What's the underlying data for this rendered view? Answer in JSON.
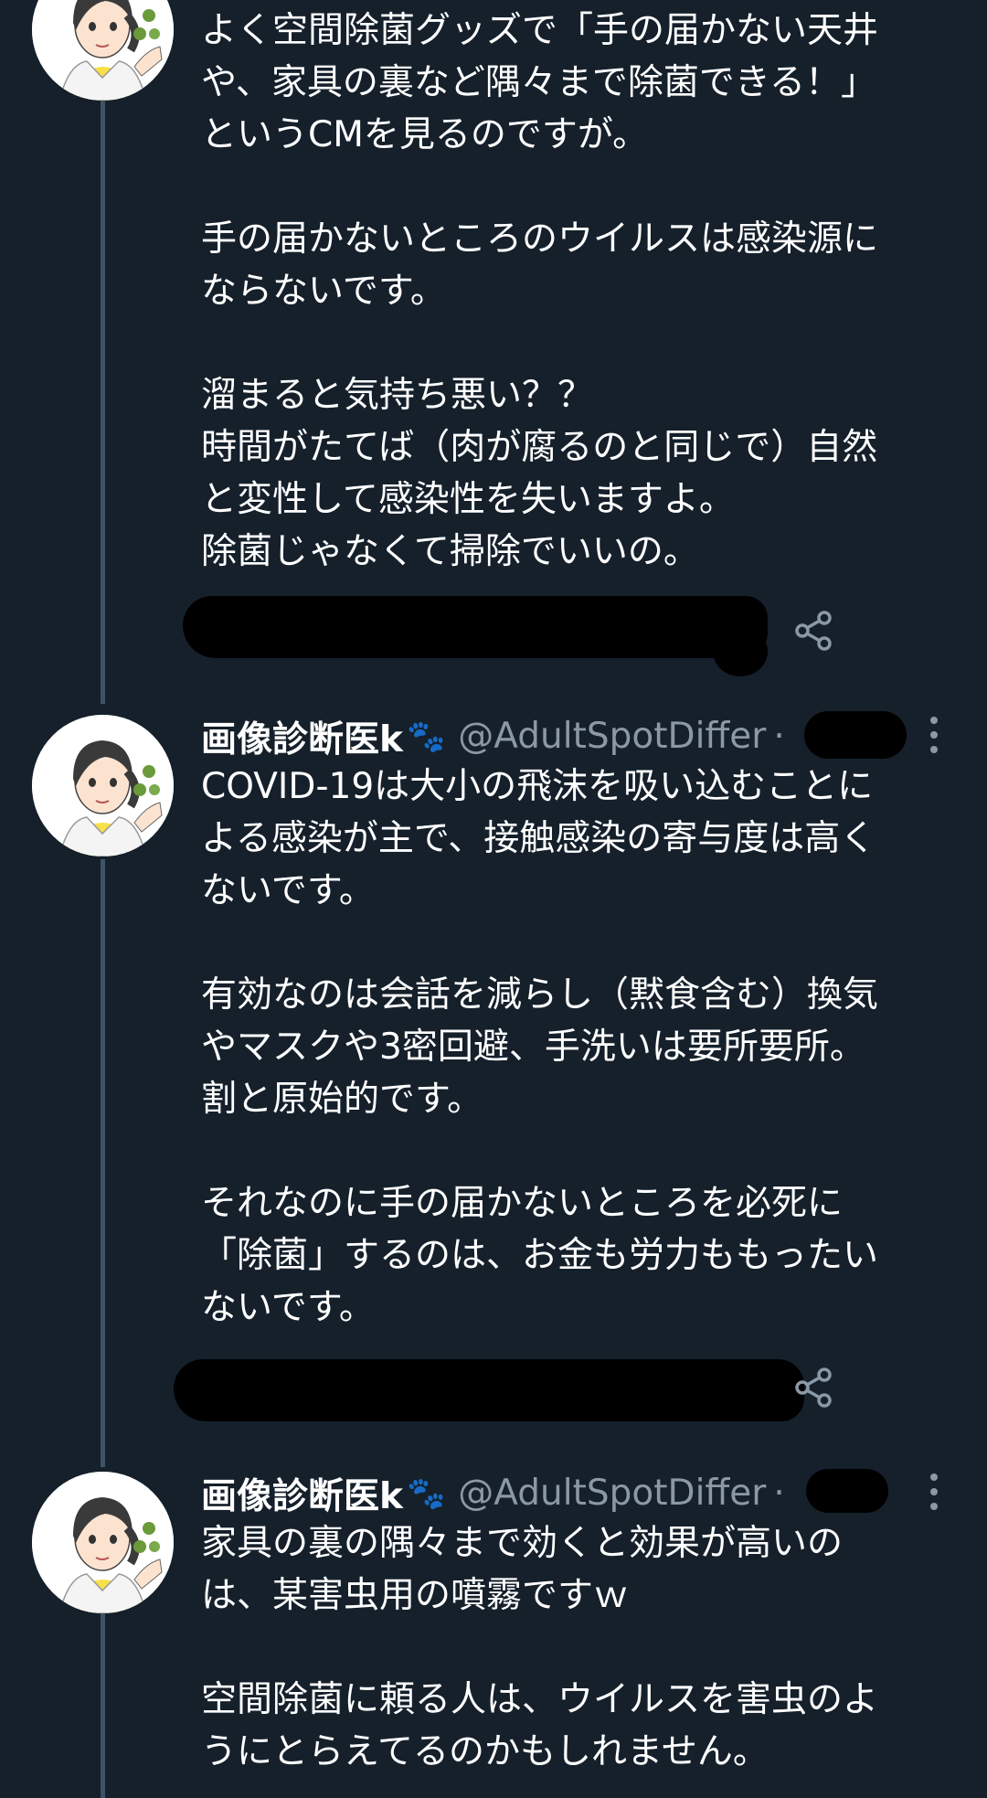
{
  "thread": {
    "tweets": [
      {
        "text": "よく空間除菌グッズで「手の届かない天井\nや、家具の裏など隅々まで除菌できる！」\nというCMを見るのですが。\n\n手の届かないところのウイルスは感染源に\nならないです。\n\n溜まると気持ち悪い？？\n時間がたてば（肉が腐るのと同じで）自然\nと変性して感染性を失いますよ。\n除菌じゃなくて掃除でいいの。"
      },
      {
        "author": {
          "name": "画像診断医k",
          "handle": "@AdultSpotDiffer",
          "separator": "·"
        },
        "text": "COVID-19は大小の飛沫を吸い込むことに\nよる感染が主で、接触感染の寄与度は高く\nないです。\n\n有効なのは会話を減らし（黙食含む）換気\nやマスクや3密回避、手洗いは要所要所。\n割と原始的です。\n\nそれなのに手の届かないところを必死に\n「除菌」するのは、お金も労力ももったい\nないです。"
      },
      {
        "author": {
          "name": "画像診断医k",
          "handle": "@AdultSpotDiffer",
          "separator": "·"
        },
        "text": "家具の裏の隅々まで効くと効果が高いの\nは、某害虫用の噴霧ですｗ\n\n空間除菌に頼る人は、ウイルスを害虫のよ\nうにとらえてるのかもしれません。"
      }
    ]
  },
  "icons": {
    "paw": "🐾",
    "share": "share-icon",
    "more": "more-vertical-icon",
    "like": "heart-icon"
  },
  "colors": {
    "background": "#15202b",
    "text": "#ffffff",
    "secondary_text": "#8b98a5",
    "thread_line": "#3d5466",
    "redaction": "#000000"
  }
}
